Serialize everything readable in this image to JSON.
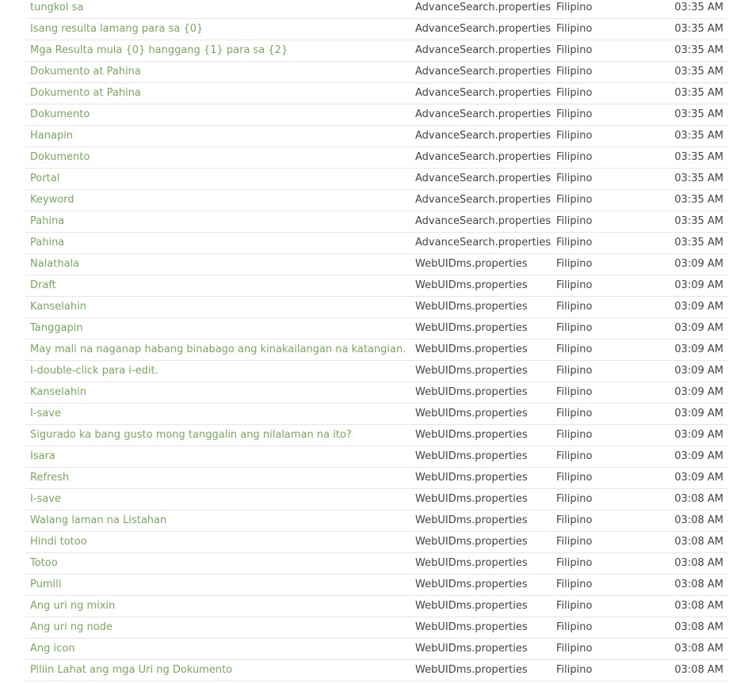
{
  "rows": [
    {
      "text": "tungkol sa",
      "file": "AdvanceSearch.properties",
      "language": "Filipino",
      "time": "03:35 AM"
    },
    {
      "text": "Isang resulta lamang para sa {0}",
      "file": "AdvanceSearch.properties",
      "language": "Filipino",
      "time": "03:35 AM"
    },
    {
      "text": "Mga Resulta mula {0} hanggang {1} para sa {2}",
      "file": "AdvanceSearch.properties",
      "language": "Filipino",
      "time": "03:35 AM"
    },
    {
      "text": "Dokumento at Pahina",
      "file": "AdvanceSearch.properties",
      "language": "Filipino",
      "time": "03:35 AM"
    },
    {
      "text": "Dokumento at Pahina",
      "file": "AdvanceSearch.properties",
      "language": "Filipino",
      "time": "03:35 AM"
    },
    {
      "text": "Dokumento",
      "file": "AdvanceSearch.properties",
      "language": "Filipino",
      "time": "03:35 AM"
    },
    {
      "text": "Hanapin",
      "file": "AdvanceSearch.properties",
      "language": "Filipino",
      "time": "03:35 AM"
    },
    {
      "text": "Dokumento",
      "file": "AdvanceSearch.properties",
      "language": "Filipino",
      "time": "03:35 AM"
    },
    {
      "text": "Portal",
      "file": "AdvanceSearch.properties",
      "language": "Filipino",
      "time": "03:35 AM"
    },
    {
      "text": "Keyword",
      "file": "AdvanceSearch.properties",
      "language": "Filipino",
      "time": "03:35 AM"
    },
    {
      "text": "Pahina",
      "file": "AdvanceSearch.properties",
      "language": "Filipino",
      "time": "03:35 AM"
    },
    {
      "text": "Pahina",
      "file": "AdvanceSearch.properties",
      "language": "Filipino",
      "time": "03:35 AM"
    },
    {
      "text": "Nalathala",
      "file": "WebUIDms.properties",
      "language": "Filipino",
      "time": "03:09 AM"
    },
    {
      "text": "Draft",
      "file": "WebUIDms.properties",
      "language": "Filipino",
      "time": "03:09 AM"
    },
    {
      "text": "Kanselahin",
      "file": "WebUIDms.properties",
      "language": "Filipino",
      "time": "03:09 AM"
    },
    {
      "text": "Tanggapin",
      "file": "WebUIDms.properties",
      "language": "Filipino",
      "time": "03:09 AM"
    },
    {
      "text": "May mali na naganap habang binabago ang kinakailangan na katangian.",
      "file": "WebUIDms.properties",
      "language": "Filipino",
      "time": "03:09 AM"
    },
    {
      "text": "I-double-click para i-edit.",
      "file": "WebUIDms.properties",
      "language": "Filipino",
      "time": "03:09 AM"
    },
    {
      "text": "Kanselahin",
      "file": "WebUIDms.properties",
      "language": "Filipino",
      "time": "03:09 AM"
    },
    {
      "text": "I-save",
      "file": "WebUIDms.properties",
      "language": "Filipino",
      "time": "03:09 AM"
    },
    {
      "text": "Sigurado ka bang gusto mong tanggalin ang nilalaman na ito?",
      "file": "WebUIDms.properties",
      "language": "Filipino",
      "time": "03:09 AM"
    },
    {
      "text": "Isara",
      "file": "WebUIDms.properties",
      "language": "Filipino",
      "time": "03:09 AM"
    },
    {
      "text": "Refresh",
      "file": "WebUIDms.properties",
      "language": "Filipino",
      "time": "03:09 AM"
    },
    {
      "text": "I-save",
      "file": "WebUIDms.properties",
      "language": "Filipino",
      "time": "03:08 AM"
    },
    {
      "text": "Walang laman na Listahan",
      "file": "WebUIDms.properties",
      "language": "Filipino",
      "time": "03:08 AM"
    },
    {
      "text": "Hindi totoo",
      "file": "WebUIDms.properties",
      "language": "Filipino",
      "time": "03:08 AM"
    },
    {
      "text": "Totoo",
      "file": "WebUIDms.properties",
      "language": "Filipino",
      "time": "03:08 AM"
    },
    {
      "text": "Pumili",
      "file": "WebUIDms.properties",
      "language": "Filipino",
      "time": "03:08 AM"
    },
    {
      "text": "Ang uri ng mixin",
      "file": "WebUIDms.properties",
      "language": "Filipino",
      "time": "03:08 AM"
    },
    {
      "text": "Ang uri ng node",
      "file": "WebUIDms.properties",
      "language": "Filipino",
      "time": "03:08 AM"
    },
    {
      "text": "Ang icon",
      "file": "WebUIDms.properties",
      "language": "Filipino",
      "time": "03:08 AM"
    },
    {
      "text": "Piliin Lahat ang mga Uri ng Dokumento",
      "file": "WebUIDms.properties",
      "language": "Filipino",
      "time": "03:08 AM"
    }
  ],
  "colors": {
    "link": "#7aa85e",
    "text": "#444444",
    "divider": "#e6e6e6",
    "background": "#ffffff"
  }
}
